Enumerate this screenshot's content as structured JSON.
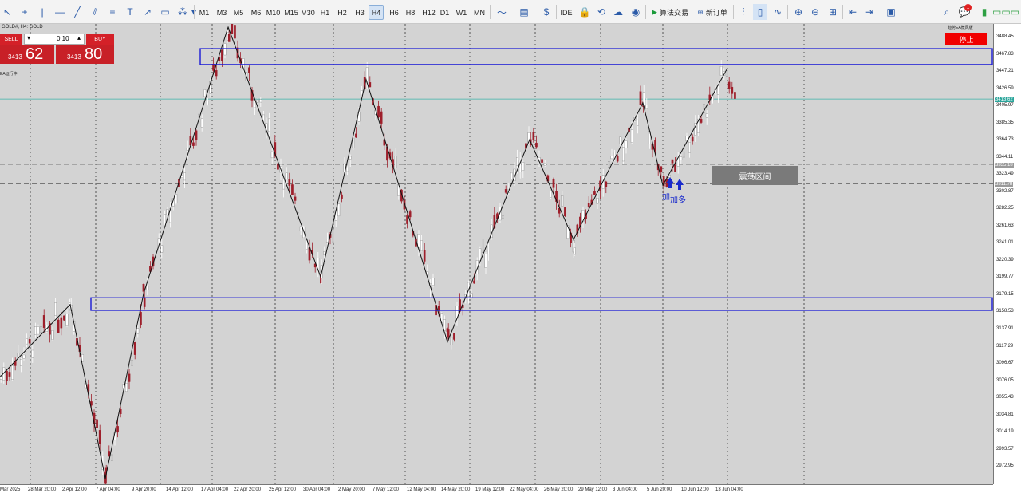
{
  "toolbar": {
    "timeframes": [
      "M1",
      "M3",
      "M5",
      "M6",
      "M10",
      "M15",
      "M30",
      "H1",
      "H2",
      "H3",
      "H4",
      "H6",
      "H8",
      "H12",
      "D1",
      "W1",
      "MN"
    ],
    "active_timeframe": "H4",
    "ide_label": "IDE",
    "algo_trading_label": "算法交易",
    "new_order_label": "新订单",
    "notification_count": "1"
  },
  "chart": {
    "symbol_line": "GOLD#, H4: GOLD",
    "ea_status": "EA运行中",
    "ea_name": "趋势EA微风版",
    "stop_button": "停止",
    "range_label": "震荡区间",
    "signal_label_1": "加",
    "signal_label_2": "加多"
  },
  "trade_panel": {
    "sell_label": "SELL",
    "buy_label": "BUY",
    "lot_size": "0.10",
    "sell_price_prefix": "3413",
    "sell_price_big": "62",
    "buy_price_prefix": "3413",
    "buy_price_big": "80"
  },
  "price_scale": {
    "labels": [
      "3488.45",
      "3467.83",
      "3447.21",
      "3426.59",
      "3405.97",
      "3385.35",
      "3364.73",
      "3344.11",
      "3323.49",
      "3302.87",
      "3282.25",
      "3261.63",
      "3241.01",
      "3220.39",
      "3199.77",
      "3179.15",
      "3158.53",
      "3137.91",
      "3117.29",
      "3096.67",
      "3076.05",
      "3055.43",
      "3034.81",
      "3014.19",
      "2993.57",
      "2972.95"
    ],
    "current_tag": "3413.62",
    "tag_upper": "3335.18",
    "tag_lower": "3311.78"
  },
  "time_scale": {
    "labels": [
      "Mar 2025",
      "28 Mar 20:00",
      "2 Apr 12:00",
      "7 Apr 04:00",
      "9 Apr 20:00",
      "14 Apr 12:00",
      "17 Apr 04:00",
      "22 Apr 20:00",
      "25 Apr 12:00",
      "30 Apr 04:00",
      "2 May 20:00",
      "7 May 12:00",
      "12 May 04:00",
      "14 May 20:00",
      "19 May 12:00",
      "22 May 04:00",
      "26 May 20:00",
      "29 May 12:00",
      "3 Jun 04:00",
      "5 Jun 20:00",
      "10 Jun 12:00",
      "13 Jun 04:00"
    ]
  },
  "colors": {
    "chart_bg": "#d3d3d3",
    "bull_candle": "#ffffff",
    "bear_candle": "#9e1f2b",
    "zone_border": "#1a1ad6",
    "stop_red": "#f10000"
  },
  "chart_data": {
    "type": "candlestick",
    "title": "GOLD#, H4",
    "zigzag_prices": [
      3080,
      3167,
      2958,
      3180,
      3500,
      3200,
      3437,
      3122,
      3365,
      3245,
      3409,
      3310,
      3449
    ],
    "zones": [
      {
        "name": "resistance-zone",
        "price_high": 3474,
        "price_low": 3455
      },
      {
        "name": "support-zone",
        "price_high": 3175,
        "price_low": 3160
      }
    ],
    "range": {
      "high": 3335.18,
      "low": 3311.78
    },
    "current_price": 3413.62,
    "ylim": [
      2960,
      3500
    ]
  }
}
